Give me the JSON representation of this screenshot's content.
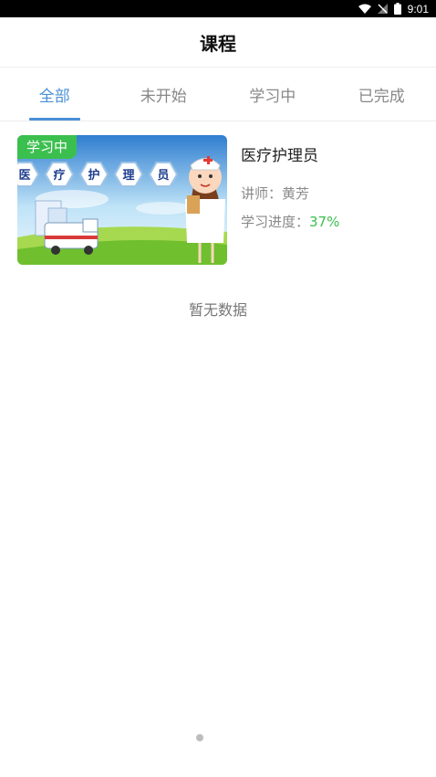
{
  "status_bar": {
    "time": "9:01"
  },
  "header": {
    "title": "课程"
  },
  "tabs": [
    {
      "label": "全部",
      "active": true
    },
    {
      "label": "未开始",
      "active": false
    },
    {
      "label": "学习中",
      "active": false
    },
    {
      "label": "已完成",
      "active": false
    }
  ],
  "course": {
    "badge": "学习中",
    "thumb_chars": [
      "医",
      "疗",
      "护",
      "理",
      "员"
    ],
    "name": "医疗护理员",
    "instructor_label": "讲师：",
    "instructor": "黄芳",
    "progress_label": "学习进度：",
    "progress": "37%"
  },
  "empty_text": "暂无数据",
  "colors": {
    "accent": "#4a8fd6",
    "success": "#3bbf4e"
  }
}
